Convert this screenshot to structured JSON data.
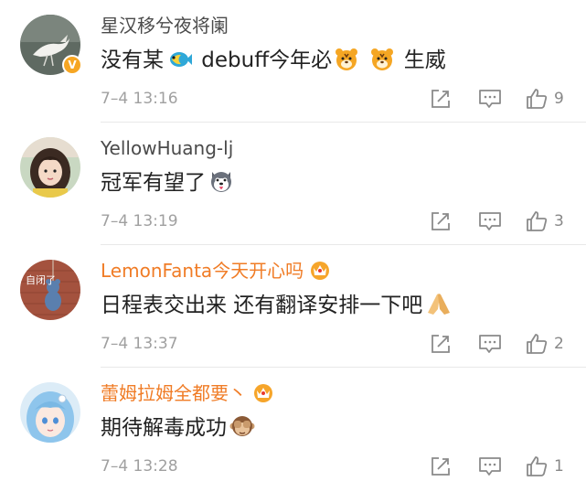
{
  "comments": [
    {
      "username": "星汉移兮夜将阑",
      "text_parts": [
        "没有某",
        " debuff今年必",
        " ",
        " 生威"
      ],
      "timestamp": "7–4 13:16",
      "likes": "9",
      "verified_badge": "V"
    },
    {
      "username": "YellowHuang-lj",
      "text_parts": [
        "冠军有望了"
      ],
      "timestamp": "7–4 13:19",
      "likes": "3"
    },
    {
      "username": "LemonFanta今天开心吗",
      "avatar_text": "自闭了",
      "text_parts": [
        "日程表交出来 还有翻译安排一下吧"
      ],
      "timestamp": "7–4 13:37",
      "likes": "2"
    },
    {
      "username": "蕾姆拉姆全都要丶",
      "text_parts": [
        "期待解毒成功"
      ],
      "timestamp": "7–4 13:28",
      "likes": "1"
    }
  ],
  "colors": {
    "vip_username": "#f07c26",
    "normal_username": "#4a4a4a",
    "timestamp": "#a0a0a0",
    "icon_stroke": "#8a8a8a"
  }
}
